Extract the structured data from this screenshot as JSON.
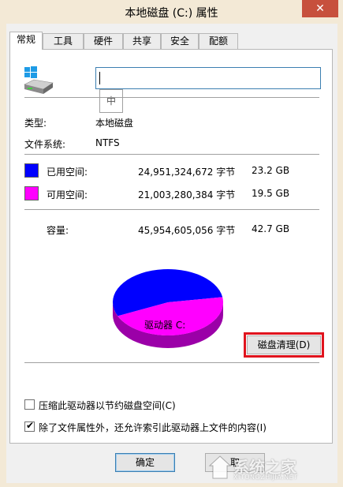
{
  "window": {
    "title": "本地磁盘 (C:) 属性",
    "close_glyph": "✕"
  },
  "tabs": [
    {
      "label": "常规",
      "active": true
    },
    {
      "label": "工具",
      "active": false
    },
    {
      "label": "硬件",
      "active": false
    },
    {
      "label": "共享",
      "active": false
    },
    {
      "label": "安全",
      "active": false
    },
    {
      "label": "配额",
      "active": false
    }
  ],
  "drive": {
    "name_value": "",
    "ime_indicator": "中",
    "type_label": "类型:",
    "type_value": "本地磁盘",
    "fs_label": "文件系统:",
    "fs_value": "NTFS"
  },
  "space": {
    "used": {
      "label": "已用空间:",
      "bytes": "24,951,324,672 字节",
      "size": "23.2 GB",
      "color": "#0000ff"
    },
    "free": {
      "label": "可用空间:",
      "bytes": "21,003,280,384 字节",
      "size": "19.5 GB",
      "color": "#ff00ff"
    },
    "capacity": {
      "label": "容量:",
      "bytes": "45,954,605,056 字节",
      "size": "42.7 GB"
    },
    "used_fraction": 0.543
  },
  "drive_label": "驱动器 C:",
  "cleanup_button": "磁盘清理(D)",
  "options": {
    "compress": {
      "label": "压缩此驱动器以节约磁盘空间(C)",
      "checked": false
    },
    "index": {
      "label": "除了文件属性外，还允许索引此驱动器上文件的内容(I)",
      "checked": true
    }
  },
  "buttons": {
    "ok": "确定",
    "cancel": "取"
  },
  "watermark": {
    "text": "系统之家",
    "sub": "XITONGZHIJIA.NET"
  }
}
